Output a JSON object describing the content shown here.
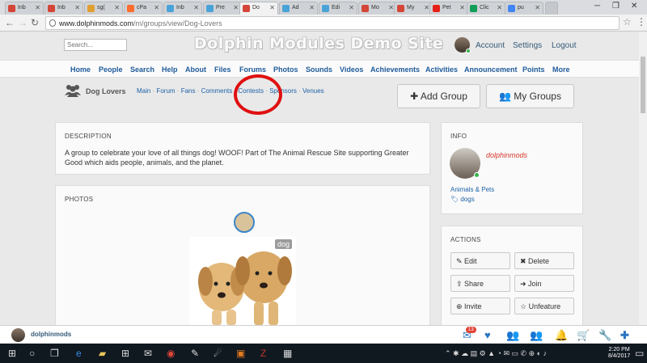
{
  "browser": {
    "tabs": [
      {
        "label": "Inb",
        "icon": "gmail-icon",
        "color": "#d44638"
      },
      {
        "label": "Inb",
        "icon": "gmail-icon",
        "color": "#d44638"
      },
      {
        "label": "sg(",
        "icon": "chart-icon",
        "color": "#e0a030"
      },
      {
        "label": "cPa",
        "icon": "cpanel-icon",
        "color": "#ff6c2c"
      },
      {
        "label": "Inb",
        "icon": "link-icon",
        "color": "#4aa3d8"
      },
      {
        "label": "Pre",
        "icon": "link-icon",
        "color": "#4aa3d8"
      },
      {
        "label": "Do",
        "icon": "pause-icon",
        "color": "#d44638"
      },
      {
        "label": "Ad",
        "icon": "link-icon",
        "color": "#4aa3d8"
      },
      {
        "label": "Edi",
        "icon": "link-icon",
        "color": "#4aa3d8"
      },
      {
        "label": "Mo",
        "icon": "pause-icon",
        "color": "#d44638"
      },
      {
        "label": "My",
        "icon": "pause-icon",
        "color": "#d44638"
      },
      {
        "label": "Pet",
        "icon": "youtube-icon",
        "color": "#e62117"
      },
      {
        "label": "Clic",
        "icon": "sheet-icon",
        "color": "#0f9d58"
      },
      {
        "label": "pu",
        "icon": "google-icon",
        "color": "#4285f4"
      }
    ],
    "url_host": "www.dolphinmods.com",
    "url_path": "/m/groups/view/Dog-Lovers"
  },
  "header": {
    "search_placeholder": "Search...",
    "site_title": "Dolphin Modules Demo Site",
    "account": "Account",
    "settings": "Settings",
    "logout": "Logout"
  },
  "nav": [
    "Home",
    "People",
    "Search",
    "Help",
    "About",
    "Files",
    "Forums",
    "Photos",
    "Sounds",
    "Videos",
    "Achievements",
    "Activities",
    "Announcement",
    "Points",
    "More"
  ],
  "group": {
    "name": "Dog Lovers",
    "tabs": [
      "Main",
      "Forum",
      "Fans",
      "Comments",
      "Contests",
      "Sponsors",
      "Venues"
    ],
    "add_group": "Add Group",
    "my_groups": "My Groups"
  },
  "description": {
    "title": "DESCRIPTION",
    "text": "A group to celebrate your love of all things dog! WOOF! Part of The Animal Rescue Site supporting Greater Good which aids people, animals, and the planet."
  },
  "photos": {
    "title": "PHOTOS",
    "tag": "dog"
  },
  "info": {
    "title": "INFO",
    "user": "dolphinmods",
    "category": "Animals & Pets",
    "tag": "dogs"
  },
  "actions": {
    "title": "ACTIONS",
    "edit": "Edit",
    "delete": "Delete",
    "share": "Share",
    "join": "Join",
    "invite": "Invite",
    "unfeature": "Unfeature"
  },
  "chatbar": {
    "user": "dolphinmods",
    "notifications": "13"
  },
  "taskbar": {
    "time": "2:20 PM",
    "date": "8/4/2017"
  },
  "colors": {
    "link": "#1e62a8",
    "highlight": "#e01010",
    "online": "#36b44a"
  }
}
